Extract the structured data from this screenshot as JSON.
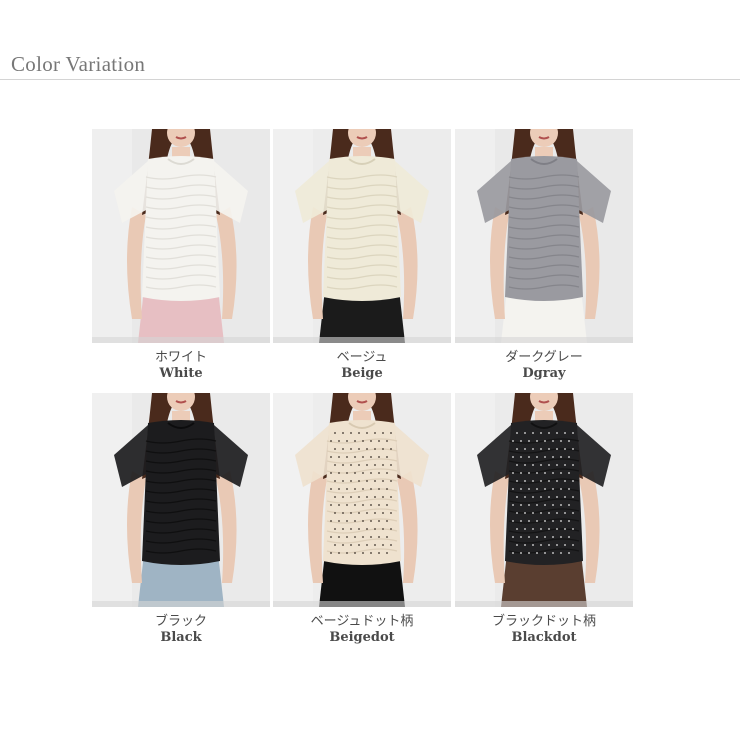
{
  "header": {
    "title": "Color Variation"
  },
  "colors": [
    {
      "jp": "ホワイト",
      "en": "White",
      "shirt": "#f4f3ef",
      "shade": "#dcdad3",
      "bottom": "#e7bfc3",
      "bg": "#e9e9e9"
    },
    {
      "jp": "ベージュ",
      "en": "Beige",
      "shirt": "#efead8",
      "shade": "#d7d0b8",
      "bottom": "#1b1b1b",
      "bg": "#ececec"
    },
    {
      "jp": "ダークグレー",
      "en": "Dgray",
      "shirt": "#9a9aa0",
      "shade": "#7f7f86",
      "bottom": "#f4f3ef",
      "bg": "#e9e9e9"
    },
    {
      "jp": "ブラック",
      "en": "Black",
      "shirt": "#1c1c1e",
      "shade": "#0c0c0d",
      "bottom": "#9fb4c4",
      "bg": "#eaeaea"
    },
    {
      "jp": "ベージュドット柄",
      "en": "Beigedot",
      "shirt": "#efe2cf",
      "shade": "#d8c9b1",
      "bottom": "#111111",
      "bg": "#ededed"
    },
    {
      "jp": "ブラックドット柄",
      "en": "Blackdot",
      "shirt": "#222224",
      "shade": "#111112",
      "bottom": "#5a3e30",
      "bg": "#ebebeb"
    }
  ]
}
